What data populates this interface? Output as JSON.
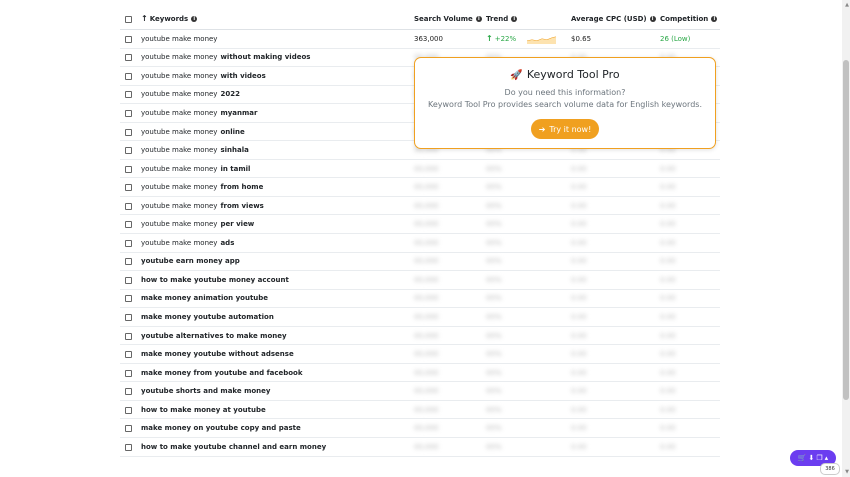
{
  "header": {
    "keywords": "Keywords",
    "search_volume": "Search Volume",
    "trend": "Trend",
    "avg_cpc": "Average CPC (USD)",
    "competition": "Competition"
  },
  "first_row": {
    "keyword": "youtube make money",
    "volume": "363,000",
    "trend": "+22%",
    "cpc": "$0.65",
    "competition": "26 (Low)"
  },
  "masked": {
    "volume": "00,000",
    "trend": "00%",
    "cpc": "0.00",
    "competition": "0.00"
  },
  "rows": [
    {
      "base": "youtube make money",
      "suffix": "without making videos"
    },
    {
      "base": "youtube make money",
      "suffix": "with videos"
    },
    {
      "base": "youtube make money",
      "suffix": "2022"
    },
    {
      "base": "youtube make money",
      "suffix": "myanmar"
    },
    {
      "base": "youtube make money",
      "suffix": "online"
    },
    {
      "base": "youtube make money",
      "suffix": "sinhala"
    },
    {
      "base": "youtube make money",
      "suffix": "in tamil"
    },
    {
      "base": "youtube make money",
      "suffix": "from home"
    },
    {
      "base": "youtube make money",
      "suffix": "from views"
    },
    {
      "base": "youtube make money",
      "suffix": "per view"
    },
    {
      "base": "youtube make money",
      "suffix": "ads"
    },
    {
      "full": "youtube earn money app"
    },
    {
      "full": "how to make youtube money account"
    },
    {
      "full": "make money animation youtube"
    },
    {
      "full": "make money youtube automation"
    },
    {
      "full": "youtube alternatives to make money"
    },
    {
      "full": "make money youtube without adsense"
    },
    {
      "full": "make money from youtube and facebook"
    },
    {
      "full": "youtube shorts and make money"
    },
    {
      "full": "how to make money at youtube"
    },
    {
      "full": "make money on youtube copy and paste"
    },
    {
      "full": "how to make youtube channel and earn money"
    }
  ],
  "popup": {
    "title": "Keyword Tool Pro",
    "question": "Do you need this information?",
    "description": "Keyword Tool Pro provides search volume data for English keywords.",
    "button": "Try it now!"
  },
  "widget": {
    "count": "386"
  },
  "colors": {
    "accent": "#f0a020",
    "positive": "#28a745",
    "widget": "#6b3df0"
  }
}
